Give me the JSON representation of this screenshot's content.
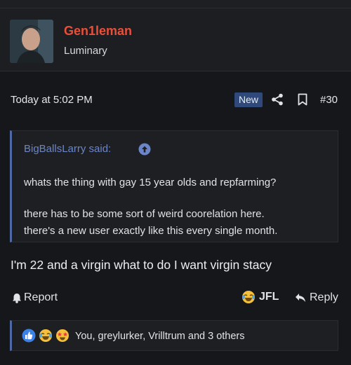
{
  "user": {
    "name": "Gen1leman",
    "title": "Luminary"
  },
  "post": {
    "date": "Today at 5:02 PM",
    "badge": "New",
    "number": "#30",
    "body": "I'm 22 and a virgin what to do I want virgin stacy"
  },
  "quote": {
    "author": "BigBallsLarry said:",
    "lines": [
      "whats the thing with gay 15 year olds and repfarming?",
      "there has to be some sort of weird coorelation here.",
      "there's a new user exactly like this every single month."
    ]
  },
  "actions": {
    "report": "Report",
    "jfl": "JFL",
    "reply": "Reply"
  },
  "reactions": {
    "summary": "You, greylurker, Vrilltrum and 3 others",
    "icons": [
      "like-icon",
      "laugh-cry-icon",
      "star-struck-icon"
    ]
  },
  "colors": {
    "username": "#e8503a",
    "accent": "#5168a6",
    "quote_author": "#6a86c9",
    "badge_bg": "#2f4a7a"
  }
}
